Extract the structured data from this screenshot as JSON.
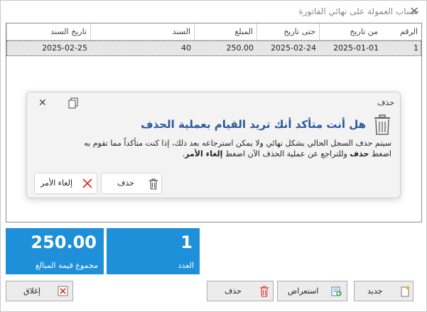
{
  "window": {
    "title": "حساب العمولة على نهائي الفاتورة"
  },
  "grid": {
    "columns": [
      "الرقم",
      "من تاريخ",
      "حتى تاريخ",
      "المبلغ",
      "السند",
      "تاريخ السند"
    ],
    "rows": [
      {
        "num": "1",
        "from": "2025-01-01",
        "to": "2025-02-24",
        "amount": "250.00",
        "voucher": "40",
        "voucher_date": "2025-02-25"
      }
    ]
  },
  "dialog": {
    "label": "حذف",
    "heading": "هل أنت متأكد أنك تريد القيام بعملية الحذف",
    "body_line1": "سيتم حذف السجل الحالي بشكل نهائي ولا يمكن استرجاعه بعد ذلك، إذا كنت متأكداً مما تقوم به",
    "body_line2_a": "اضغط ",
    "body_line2_b": "حذف",
    "body_line2_c": " وللتراجع عن عملية الحذف الآن اضغط ",
    "body_line2_d": "إلغاء الأمر",
    "body_line2_e": ".",
    "delete_label": "حذف",
    "cancel_label": "إلغاء الأمر"
  },
  "tiles": {
    "total": {
      "value": "250.00",
      "label": "مجموع قيمة المبالغ"
    },
    "count": {
      "value": "1",
      "label": "العدد"
    }
  },
  "buttons": {
    "new": "جديد",
    "browse": "استعراض",
    "delete": "حذف",
    "close": "إغلاق"
  },
  "colors": {
    "tile_blue": "#1e8fd9",
    "heading_blue": "#2b579a",
    "delete_red": "#d9302c"
  }
}
